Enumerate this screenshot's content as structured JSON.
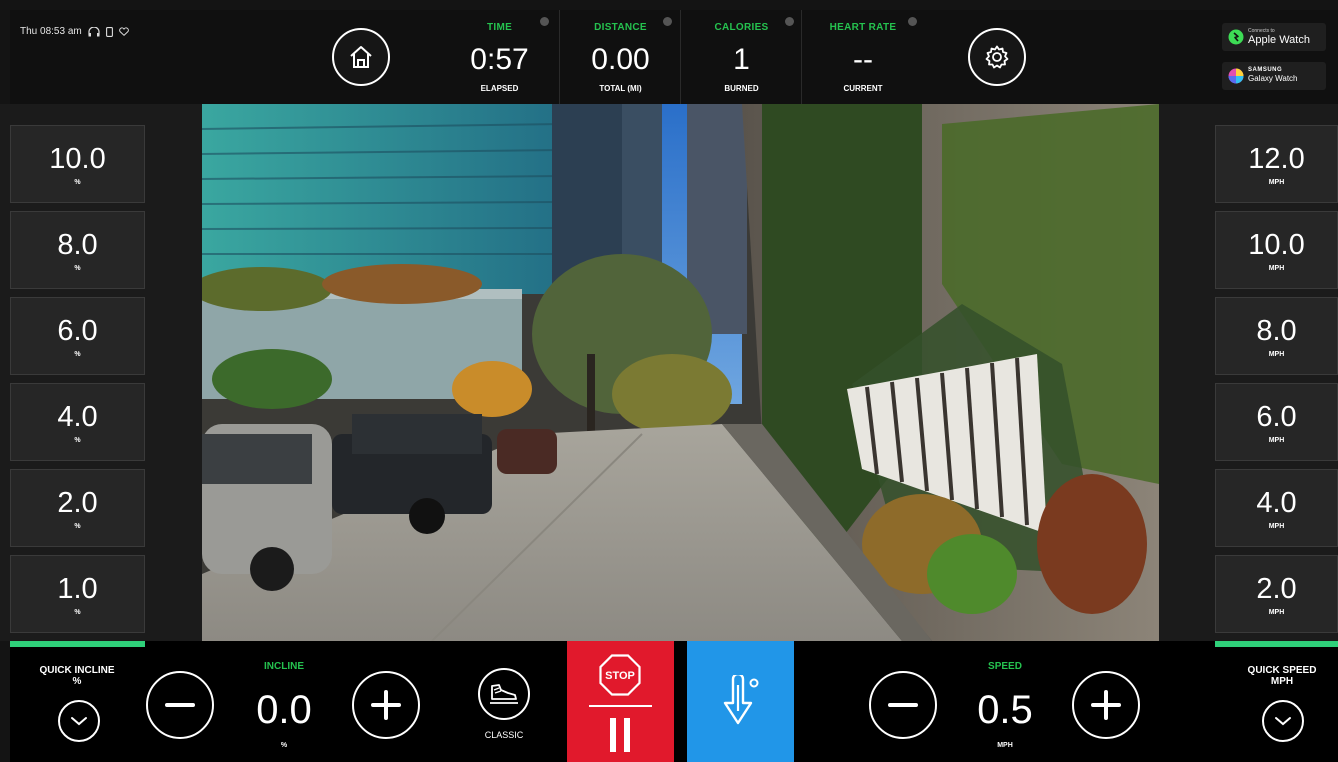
{
  "status": {
    "datetime": "Thu 08:53 am"
  },
  "stats": [
    {
      "label": "TIME",
      "value": "0:57",
      "sub": "ELAPSED"
    },
    {
      "label": "DISTANCE",
      "value": "0.00",
      "sub": "TOTAL (MI)"
    },
    {
      "label": "CALORIES",
      "value": "1",
      "sub": "BURNED"
    },
    {
      "label": "HEART RATE",
      "value": "--",
      "sub": "CURRENT"
    }
  ],
  "watches": {
    "apple": {
      "small": "Connects to",
      "name": "Apple Watch"
    },
    "samsung": {
      "small": "SAMSUNG",
      "name": "Galaxy Watch"
    }
  },
  "incline_presets": [
    {
      "value": "10.0",
      "unit": "%"
    },
    {
      "value": "8.0",
      "unit": "%"
    },
    {
      "value": "6.0",
      "unit": "%"
    },
    {
      "value": "4.0",
      "unit": "%"
    },
    {
      "value": "2.0",
      "unit": "%"
    },
    {
      "value": "1.0",
      "unit": "%"
    }
  ],
  "speed_presets": [
    {
      "value": "12.0",
      "unit": "MPH"
    },
    {
      "value": "10.0",
      "unit": "MPH"
    },
    {
      "value": "8.0",
      "unit": "MPH"
    },
    {
      "value": "6.0",
      "unit": "MPH"
    },
    {
      "value": "4.0",
      "unit": "MPH"
    },
    {
      "value": "2.0",
      "unit": "MPH"
    }
  ],
  "bottom": {
    "quick_incline": {
      "line1": "QUICK INCLINE",
      "line2": "%"
    },
    "incline": {
      "label": "INCLINE",
      "value": "0.0",
      "unit": "%"
    },
    "mode": {
      "label": "CLASSIC"
    },
    "stop": {
      "label": "STOP"
    },
    "speed": {
      "label": "SPEED",
      "value": "0.5",
      "unit": "MPH"
    },
    "quick_speed": {
      "line1": "QUICK SPEED",
      "line2": "MPH"
    }
  },
  "colors": {
    "accent_green": "#25c24f",
    "stop_red": "#e1192c",
    "cooldown_blue": "#2196e8"
  },
  "icons": [
    "home-icon",
    "gear-icon",
    "headphones-icon",
    "phone-icon",
    "heart-icon",
    "minus-icon",
    "plus-icon",
    "chevron-down-icon",
    "shoe-icon",
    "stop-sign-icon",
    "pause-icon",
    "thermometer-down-icon"
  ]
}
